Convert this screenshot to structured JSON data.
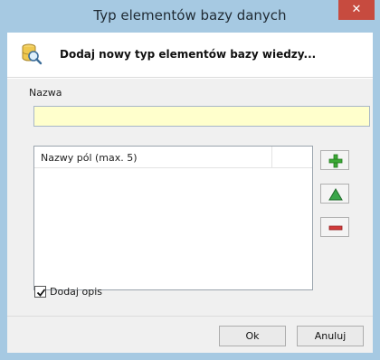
{
  "window": {
    "title": "Typ elementów bazy danych",
    "close_icon": "close-icon"
  },
  "header": {
    "icon": "database-search-icon",
    "text": "Dodaj nowy typ elementów bazy wiedzy..."
  },
  "form": {
    "name_label": "Nazwa",
    "name_value": "",
    "fields_list": {
      "header": "Nazwy pól (max. 5)",
      "items": []
    },
    "buttons": {
      "add_icon": "plus-icon",
      "up_icon": "triangle-up-icon",
      "remove_icon": "minus-icon"
    },
    "checkbox": {
      "label": "Dodaj opis",
      "checked": true
    }
  },
  "footer": {
    "ok_label": "Ok",
    "cancel_label": "Anuluj"
  },
  "colors": {
    "title_bar": "#a6c9e2",
    "close_button": "#c74b3f",
    "input_background": "#ffffcc"
  }
}
